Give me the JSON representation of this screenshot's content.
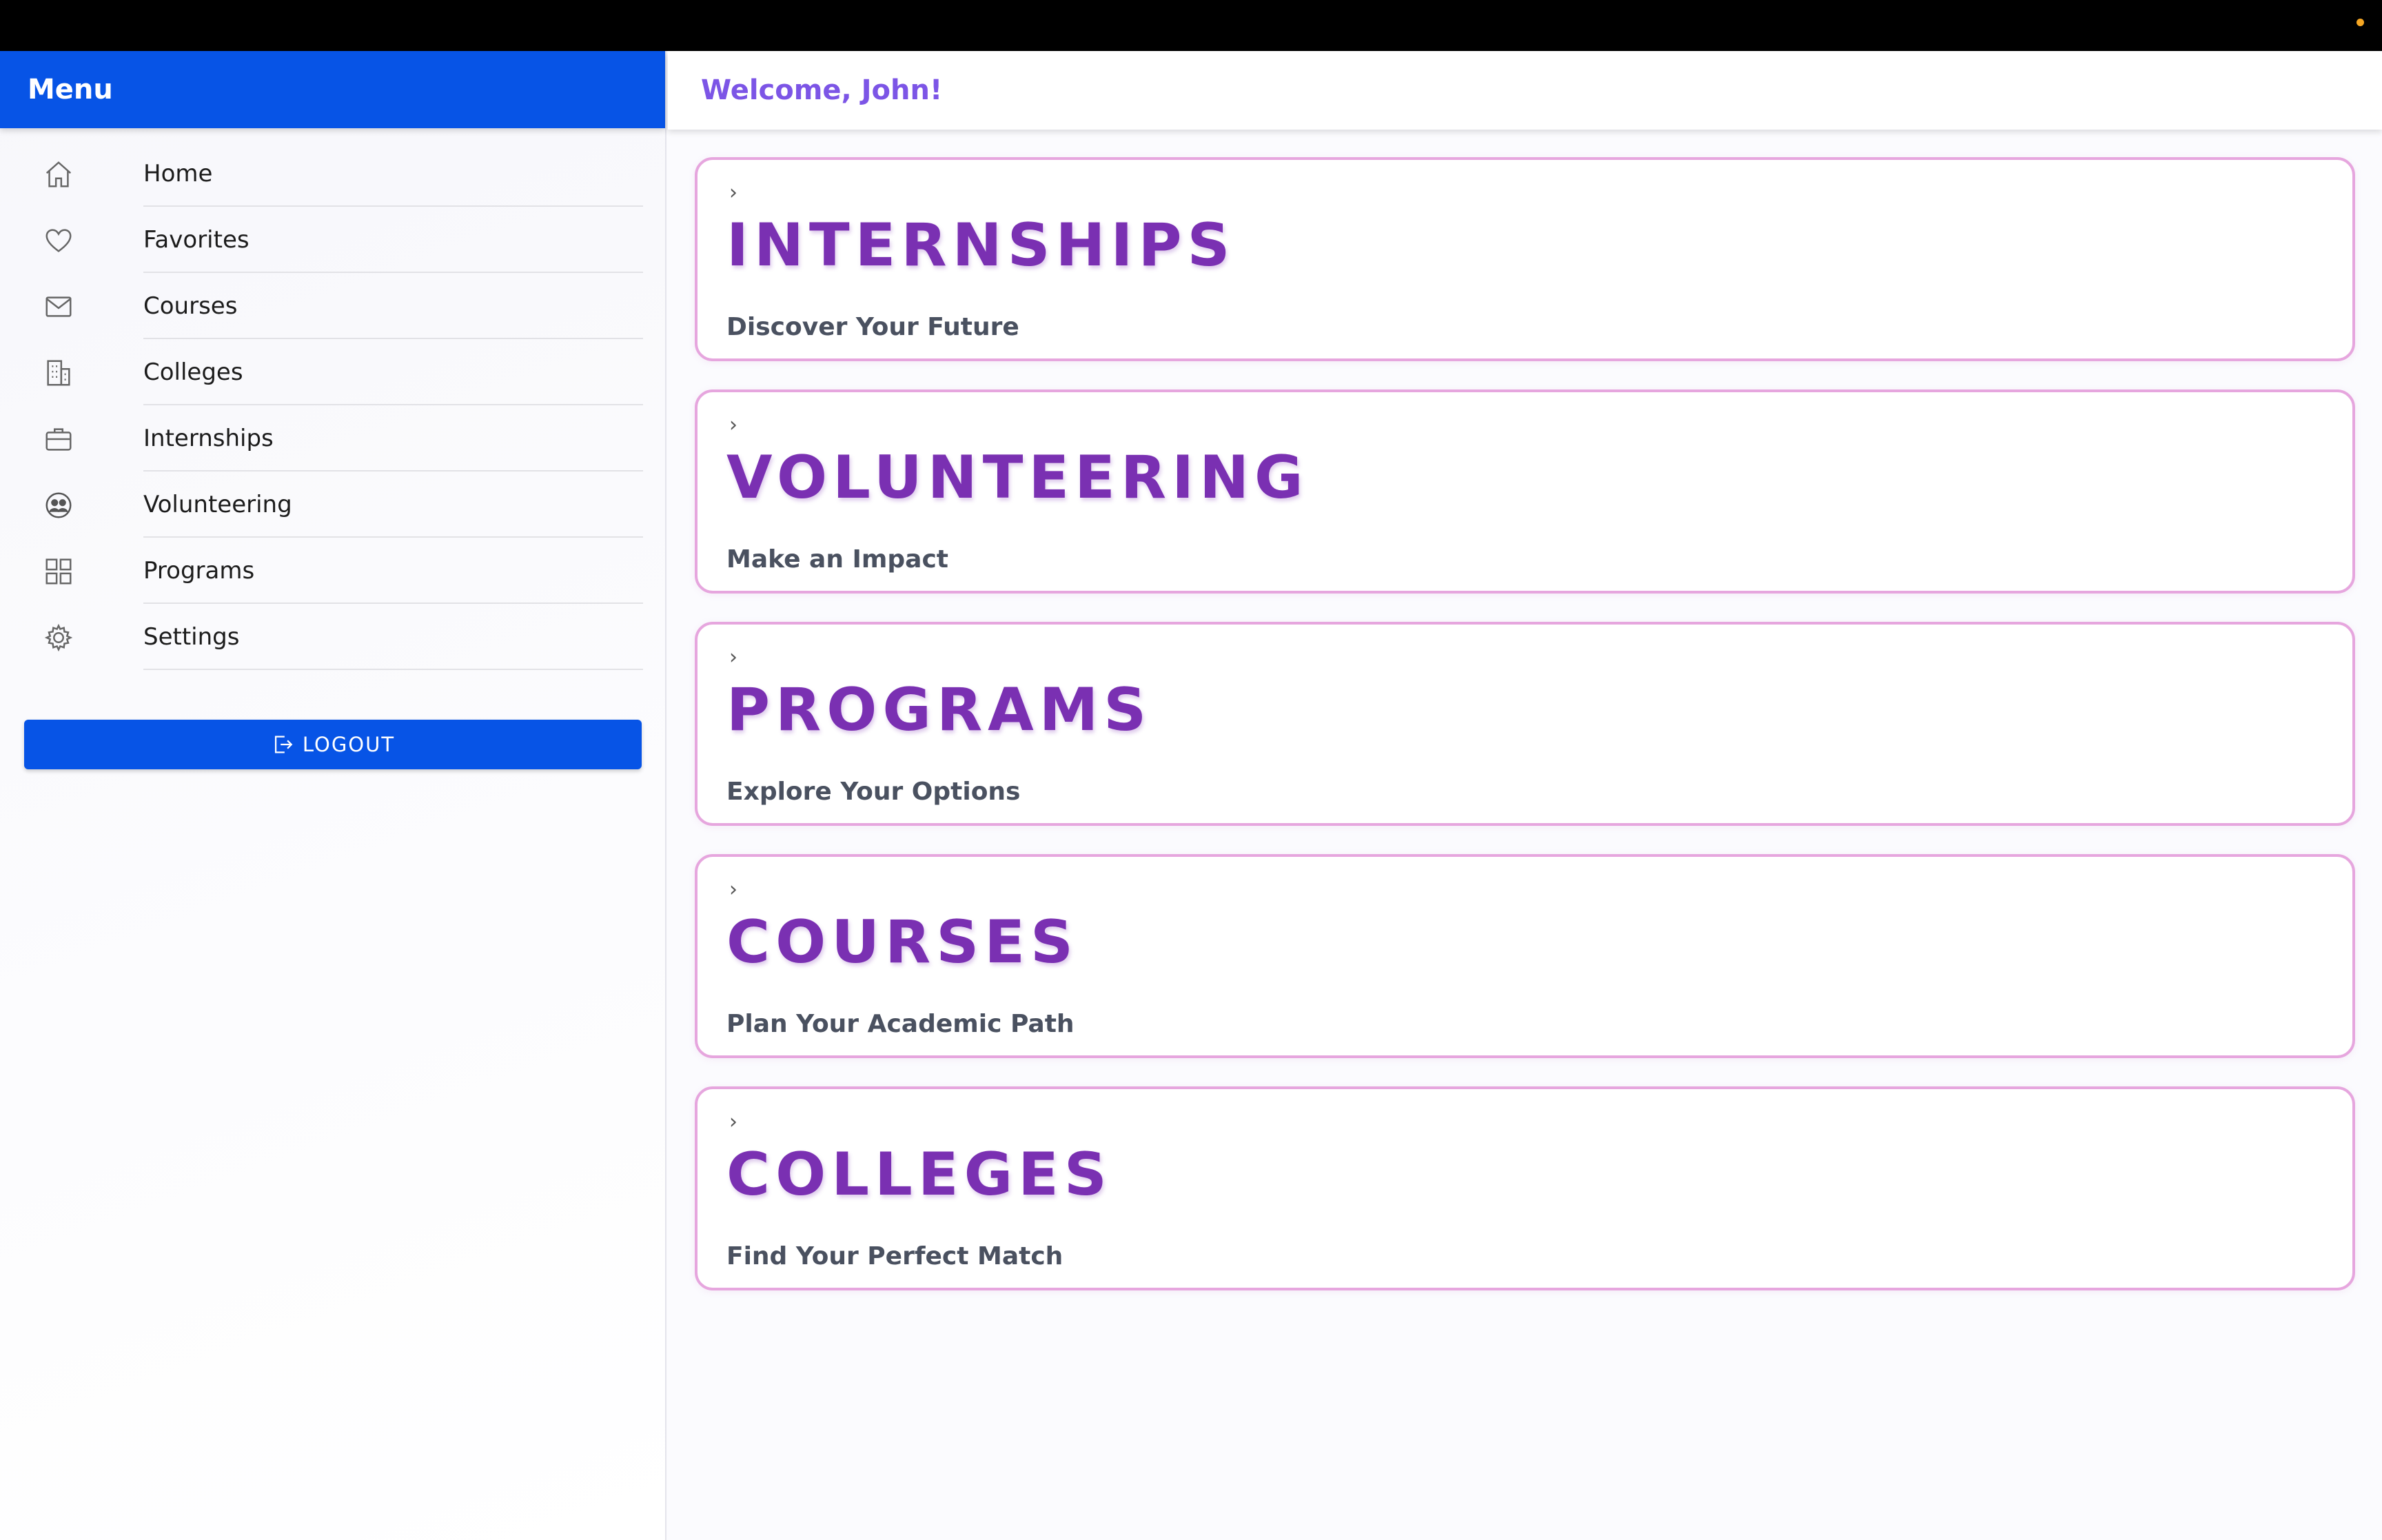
{
  "sidebar": {
    "title": "Menu",
    "items": [
      {
        "label": "Home",
        "icon": "home-icon"
      },
      {
        "label": "Favorites",
        "icon": "heart-icon"
      },
      {
        "label": "Courses",
        "icon": "mail-icon"
      },
      {
        "label": "Colleges",
        "icon": "building-icon"
      },
      {
        "label": "Internships",
        "icon": "briefcase-icon"
      },
      {
        "label": "Volunteering",
        "icon": "people-icon"
      },
      {
        "label": "Programs",
        "icon": "grid-icon"
      },
      {
        "label": "Settings",
        "icon": "gear-icon"
      }
    ],
    "logout_label": "LOGOUT"
  },
  "header": {
    "welcome": "Welcome, John!"
  },
  "cards": [
    {
      "title": "INTERNSHIPS",
      "subtitle": "Discover Your Future"
    },
    {
      "title": "VOLUNTEERING",
      "subtitle": "Make an Impact"
    },
    {
      "title": "PROGRAMS",
      "subtitle": "Explore Your Options"
    },
    {
      "title": "COURSES",
      "subtitle": "Plan Your Academic Path"
    },
    {
      "title": "COLLEGES",
      "subtitle": "Find Your Perfect Match"
    }
  ],
  "chevron_glyph": "›",
  "colors": {
    "accent": "#0754e6",
    "welcome": "#7c55e6",
    "card_title": "#7a30b2",
    "card_border": "#e6a6de"
  }
}
